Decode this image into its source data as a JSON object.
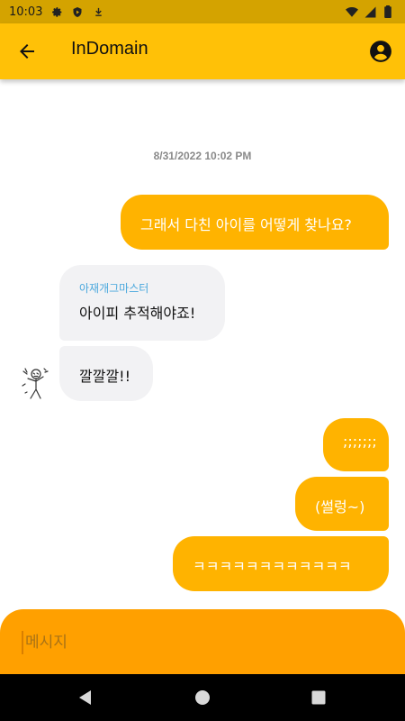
{
  "status_bar": {
    "time": "10:03",
    "left_icons": [
      "settings-icon",
      "shield-play-icon",
      "download-icon"
    ],
    "right_icons": [
      "wifi-icon",
      "signal-icon",
      "battery-icon"
    ]
  },
  "app_bar": {
    "title": "InDomain",
    "back_icon": "arrow-left-icon",
    "account_icon": "account-circle-icon",
    "color": "#FFC107"
  },
  "chat": {
    "timestamp": "8/31/2022 10:02 PM",
    "messages": [
      {
        "direction": "outgoing",
        "text": "그래서 다친 아이를 어떻게 찾나요?"
      },
      {
        "direction": "incoming",
        "sender": "아재개그마스터",
        "text": "아이피 추적해야죠!"
      },
      {
        "direction": "incoming",
        "text": "깔깔깔!!",
        "has_avatar": true
      },
      {
        "direction": "outgoing",
        "text": ";;;;;;;"
      },
      {
        "direction": "outgoing",
        "text": "(썰렁~)"
      },
      {
        "direction": "outgoing",
        "text": "ㅋㅋㅋㅋㅋㅋㅋㅋㅋㅋㅋㅋ"
      }
    ],
    "outgoing_color": "#FFB300",
    "incoming_color": "#F2F2F4",
    "sender_color": "#4AA8DD"
  },
  "composer": {
    "placeholder": "메시지",
    "value": "",
    "color": "#FFA000"
  },
  "nav_bar": {
    "icons": [
      "back-triangle-icon",
      "home-circle-icon",
      "recents-square-icon"
    ]
  }
}
